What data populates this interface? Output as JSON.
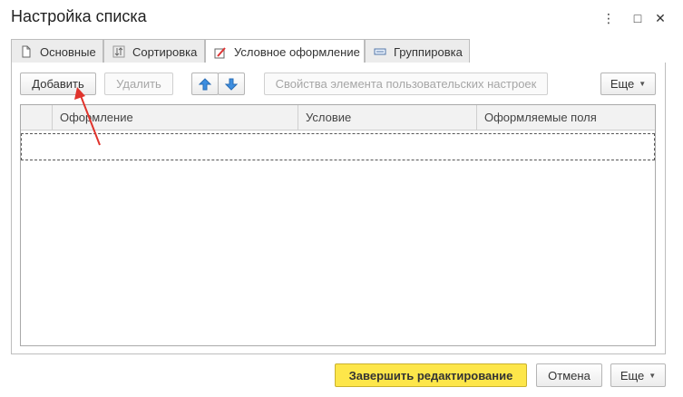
{
  "window": {
    "title": "Настройка списка",
    "controls": {
      "more": "⋮",
      "maximize": "□",
      "close": "✕"
    }
  },
  "tabs": [
    {
      "label": "Основные",
      "icon": "document-icon",
      "active": false
    },
    {
      "label": "Сортировка",
      "icon": "sort-icon",
      "active": false
    },
    {
      "label": "Условное оформление",
      "icon": "conditional-format-icon",
      "active": true
    },
    {
      "label": "Группировка",
      "icon": "grouping-icon",
      "active": false
    }
  ],
  "toolbar": {
    "add_label": "Добавить",
    "delete_label": "Удалить",
    "move_up": "up-arrow-icon",
    "move_down": "down-arrow-icon",
    "properties_label": "Свойства элемента пользовательских настроек",
    "more_label": "Еще"
  },
  "table": {
    "columns": [
      "Оформление",
      "Условие",
      "Оформляемые поля"
    ]
  },
  "footer": {
    "finish_label": "Завершить редактирование",
    "cancel_label": "Отмена",
    "more_label": "Еще"
  },
  "colors": {
    "primary_button": "#fde64a",
    "annotation_arrow": "#e0332c",
    "arrow_icon_blue": "#3d8ee0"
  }
}
